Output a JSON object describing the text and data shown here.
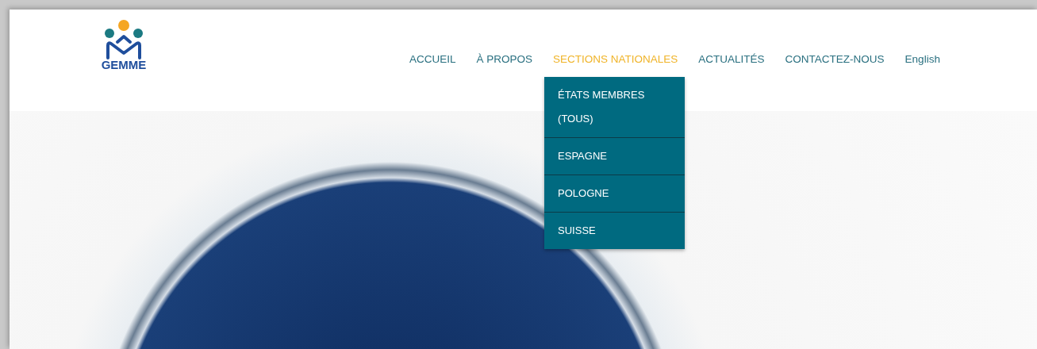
{
  "logo": {
    "text": "GEMME"
  },
  "nav": [
    {
      "label": "ACCUEIL",
      "selected": false
    },
    {
      "label": "À PROPOS",
      "selected": false
    },
    {
      "label": "SECTIONS NATIONALES",
      "selected": true,
      "expanded": true,
      "children": [
        "ÉTATS MEMBRES (TOUS)",
        "ESPAGNE",
        "POLOGNE",
        "SUISSE"
      ]
    },
    {
      "label": "ACTUALITÉS",
      "selected": false
    },
    {
      "label": "CONTACTEZ-NOUS",
      "selected": false
    },
    {
      "label": "English",
      "selected": false
    }
  ]
}
